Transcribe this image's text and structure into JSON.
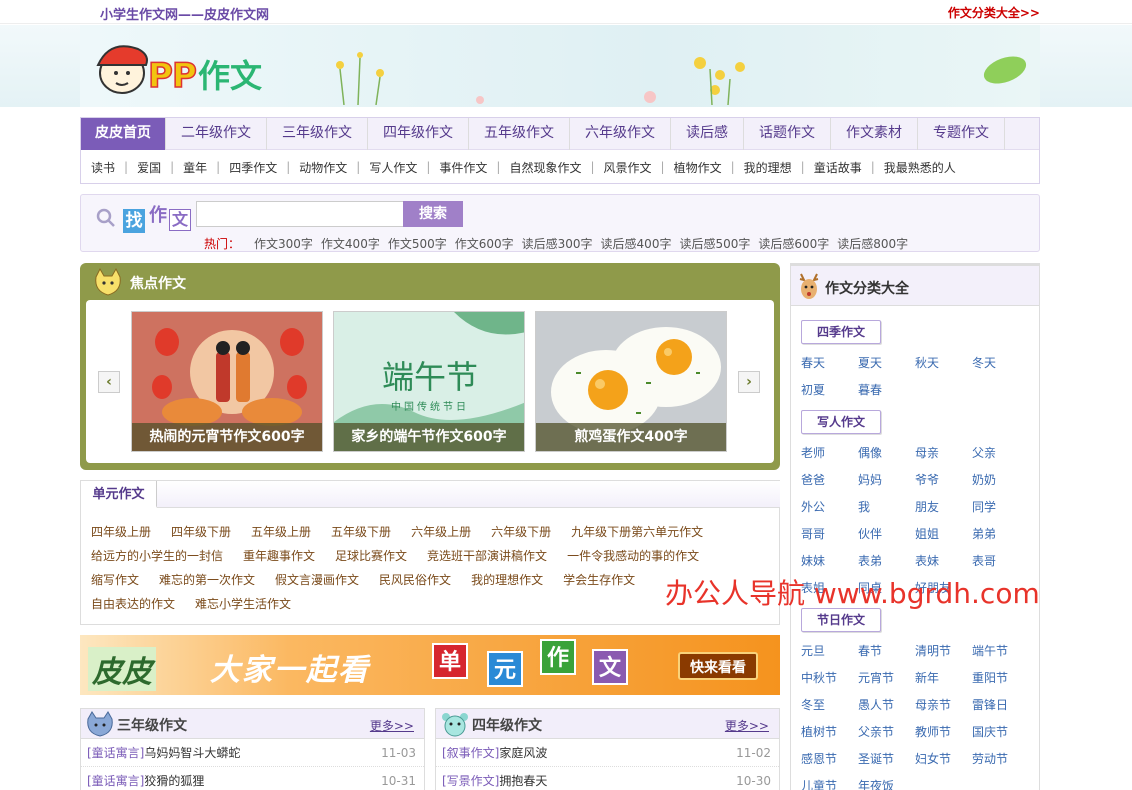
{
  "topbar": {
    "site_name": "小学生作文网——皮皮作文网",
    "right_link": "作文分类大全>>"
  },
  "banner": {
    "logo_text": "PP作文"
  },
  "nav": {
    "main": [
      "皮皮首页",
      "二年级作文",
      "三年级作文",
      "四年级作文",
      "五年级作文",
      "六年级作文",
      "读后感",
      "话题作文",
      "作文素材",
      "专题作文"
    ],
    "sub": [
      "读书",
      "爱国",
      "童年",
      "四季作文",
      "动物作文",
      "写人作文",
      "事件作文",
      "自然现象作文",
      "风景作文",
      "植物作文",
      "我的理想",
      "童话故事",
      "我最熟悉的人"
    ]
  },
  "search": {
    "logo_find": "找",
    "logo_zuo": "作",
    "logo_wen": "文",
    "placeholder": "",
    "button": "搜索",
    "hot_label": "热门：",
    "hot": [
      "作文300字",
      "作文400字",
      "作文500字",
      "作文600字",
      "读后感300字",
      "读后感400字",
      "读后感500字",
      "读后感600字",
      "读后感800字"
    ]
  },
  "focus": {
    "title": "焦点作文",
    "prev": "‹",
    "next": "›",
    "cards": [
      {
        "caption": "热闹的元宵节作文600字",
        "art": "lantern-festival"
      },
      {
        "caption": "家乡的端午节作文600字",
        "art_text": "端午节",
        "art_sub": "中国传统节日"
      },
      {
        "caption": "煎鸡蛋作文400字",
        "art": "fried-eggs"
      }
    ]
  },
  "unit": {
    "tab": "单元作文",
    "rows": [
      [
        "四年级上册",
        "四年级下册",
        "五年级上册",
        "五年级下册",
        "六年级上册",
        "六年级下册",
        "九年级下册第六单元作文"
      ],
      [
        "给远方的小学生的一封信",
        "重年趣事作文",
        "足球比赛作文",
        "竞选班干部演讲稿作文",
        "一件令我感动的事的作文"
      ],
      [
        "缩写作文",
        "难忘的第一次作文",
        "假文言漫画作文",
        "民风民俗作文",
        "我的理想作文",
        "学会生存作文"
      ],
      [
        "自由表达的作文",
        "难忘小学生活作文"
      ]
    ]
  },
  "ad": {
    "logo": "皮皮",
    "slogan": "大家一起看",
    "chars": [
      "单",
      "元",
      "作",
      "文"
    ],
    "button": "快来看看"
  },
  "col3": {
    "title": "三年级作文",
    "more": "更多>>",
    "rows": [
      {
        "tag": "[童话寓言]",
        "text": "乌妈妈智斗大蟒蛇",
        "date": "11-03"
      },
      {
        "tag": "[童话寓言]",
        "text": "狡猾的狐狸",
        "date": "10-31"
      }
    ]
  },
  "col4": {
    "title": "四年级作文",
    "more": "更多>>",
    "rows": [
      {
        "tag": "[叙事作文]",
        "text": "家庭风波",
        "date": "11-02"
      },
      {
        "tag": "[写景作文]",
        "text": "拥抱春天",
        "date": "10-30"
      }
    ]
  },
  "side": {
    "title": "作文分类大全",
    "groups": [
      {
        "tag": "四季作文",
        "items": [
          "春天",
          "夏天",
          "秋天",
          "冬天",
          "初夏",
          "暮春"
        ]
      },
      {
        "tag": "写人作文",
        "items": [
          "老师",
          "偶像",
          "母亲",
          "父亲",
          "爸爸",
          "妈妈",
          "爷爷",
          "奶奶",
          "外公",
          "我",
          "朋友",
          "同学",
          "哥哥",
          "伙伴",
          "姐姐",
          "弟弟",
          "妹妹",
          "表弟",
          "表妹",
          "表哥",
          "表姐",
          "同桌",
          "好朋友"
        ]
      },
      {
        "tag": "节日作文",
        "items": [
          "元旦",
          "春节",
          "清明节",
          "端午节",
          "中秋节",
          "元宵节",
          "新年",
          "重阳节",
          "冬至",
          "愚人节",
          "母亲节",
          "雷锋日",
          "植树节",
          "父亲节",
          "教师节",
          "国庆节",
          "感恩节",
          "圣诞节",
          "妇女节",
          "劳动节",
          "儿童节",
          "年夜饭"
        ]
      }
    ]
  },
  "watermark": "办公人导航 www.bgrdh.com",
  "colors": {
    "brand": "#7b5cb8",
    "focus_bg": "#8f9a4a",
    "link": "#3a6ab0",
    "hot": "#cc0000"
  }
}
